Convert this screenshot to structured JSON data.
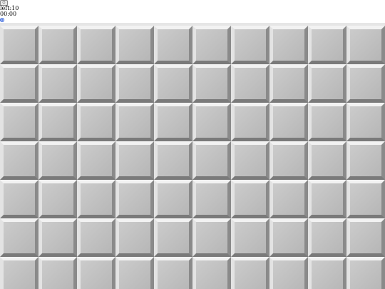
{
  "hud": {
    "face_icon": "smiley-face-icon",
    "face_glyph": "☺",
    "mines_left_label": "left:10",
    "timer": "00:00",
    "settings_icon": "settings-icon"
  },
  "board": {
    "columns": 10,
    "rows": 7,
    "cell_state": "covered"
  },
  "colors": {
    "tile_face": "#c0c0c0",
    "tile_highlight": "#f2f2f2",
    "tile_shadow": "#7a7a7a",
    "board_background": "#e6e6e6",
    "settings_accent": "#2a5bd7"
  }
}
